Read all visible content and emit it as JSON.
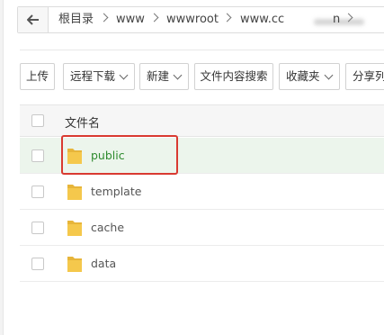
{
  "breadcrumb": {
    "back_icon": "arrow-left-icon",
    "items": [
      "根目录",
      "www",
      "wwwroot",
      "www.cc"
    ],
    "trailing_text": "n"
  },
  "toolbar": {
    "upload": "上传",
    "remote_download": "远程下载",
    "new": "新建",
    "content_search": "文件内容搜索",
    "favorites": "收藏夹",
    "share": "分享列"
  },
  "table": {
    "header_filename": "文件名",
    "rows": [
      {
        "name": "public",
        "selected": true
      },
      {
        "name": "template",
        "selected": false
      },
      {
        "name": "cache",
        "selected": false
      },
      {
        "name": "data",
        "selected": false
      }
    ]
  },
  "colors": {
    "selected_text": "#2e8b2e",
    "selected_bg": "#ecf5ec",
    "highlight_border": "#d93a31",
    "folder": "#f5c84c"
  }
}
